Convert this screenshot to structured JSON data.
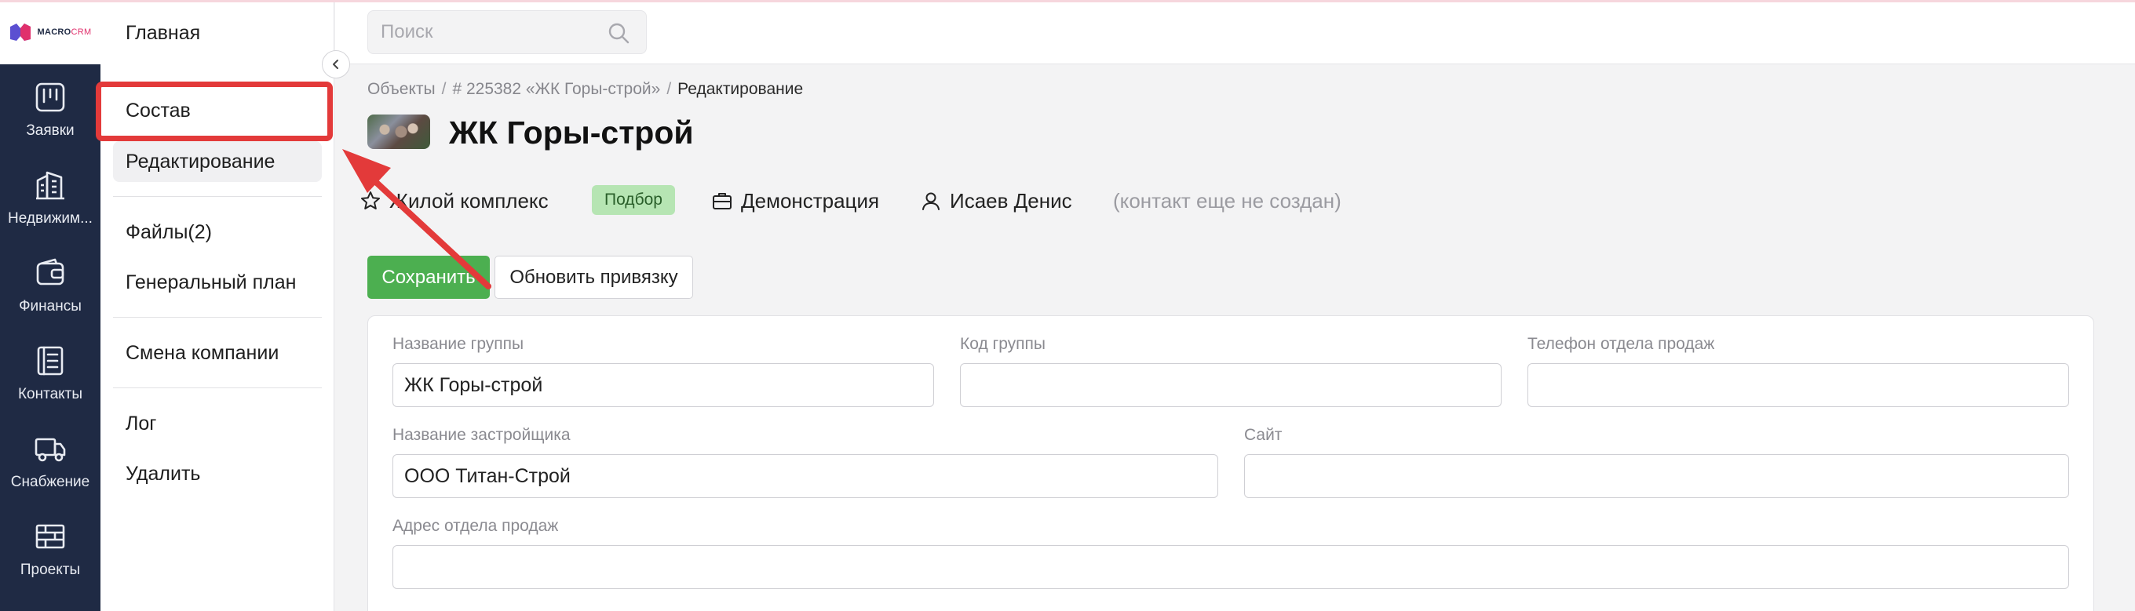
{
  "brand": {
    "logo_main": "MACRO",
    "logo_accent": "CRM"
  },
  "rail": {
    "items": [
      {
        "label": "Заявки",
        "icon": "kanban-icon"
      },
      {
        "label": "Недвижим...",
        "icon": "buildings-icon"
      },
      {
        "label": "Финансы",
        "icon": "wallet-icon"
      },
      {
        "label": "Контакты",
        "icon": "contacts-icon"
      },
      {
        "label": "Снабжение",
        "icon": "truck-icon"
      },
      {
        "label": "Проекты",
        "icon": "projects-icon"
      }
    ]
  },
  "submenu": {
    "items": [
      {
        "label": "Главная"
      },
      {
        "label": "Состав"
      },
      {
        "label": "Редактирование"
      },
      {
        "label": "Файлы(2)"
      },
      {
        "label": "Генеральный план"
      },
      {
        "label": "Смена компании"
      },
      {
        "label": "Лог"
      },
      {
        "label": "Удалить"
      }
    ],
    "active": "Редактирование",
    "highlighted": "Состав"
  },
  "search": {
    "placeholder": "Поиск"
  },
  "breadcrumb": {
    "items": [
      "Объекты",
      "# 225382 «ЖК Горы-строй»"
    ],
    "current": "Редактирование"
  },
  "page": {
    "title": "ЖК Горы-строй",
    "type": "Жилой комплекс",
    "status_badge": "Подбор",
    "mode": "Демонстрация",
    "manager": "Исаев Денис",
    "contact_note": "(контакт еще не создан)"
  },
  "actions": {
    "save": "Сохранить",
    "refresh": "Обновить привязку"
  },
  "form": {
    "group_name": {
      "label": "Название группы",
      "value": "ЖК Горы-строй"
    },
    "group_code": {
      "label": "Код группы",
      "value": ""
    },
    "sales_phone": {
      "label": "Телефон отдела продаж",
      "value": ""
    },
    "developer_name": {
      "label": "Название застройщика",
      "value": "ООО Титан-Строй"
    },
    "site": {
      "label": "Сайт",
      "value": ""
    },
    "sales_address": {
      "label": "Адрес отдела продаж",
      "value": ""
    }
  },
  "colors": {
    "rail_bg": "#1f2a44",
    "accent_green": "#4caf50",
    "badge_green": "#b6e5b3",
    "annotation_red": "#e33a3a"
  }
}
